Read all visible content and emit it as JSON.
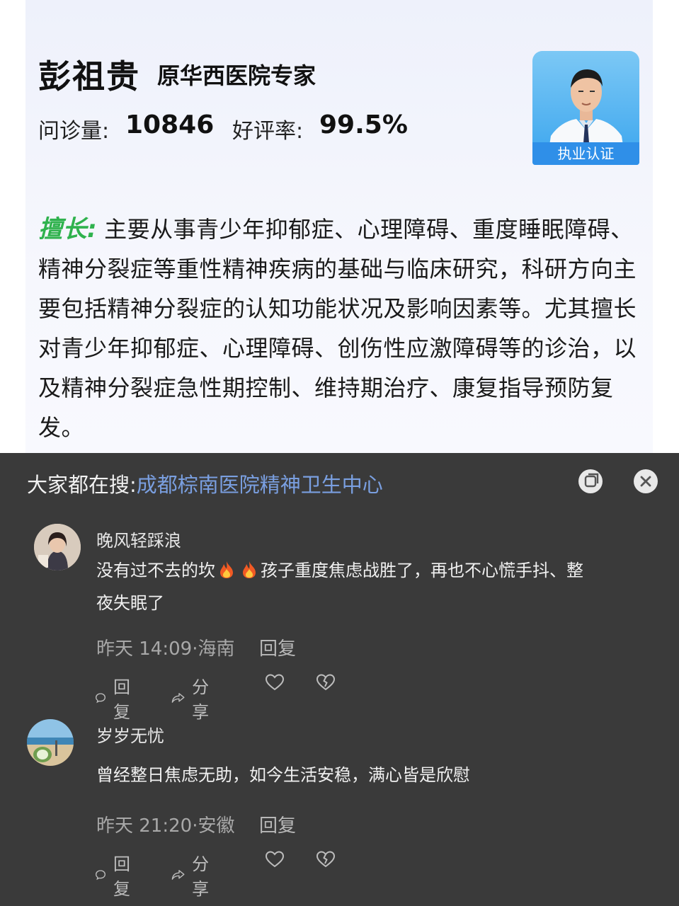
{
  "doctor": {
    "name": "彭祖贵",
    "title": "原华西医院专家",
    "consults_label": "问诊量:",
    "consults_value": "10846",
    "rating_label": "好评率:",
    "rating_value": "99.5%",
    "cert_label": "执业认证",
    "specialty_tag": "擅长:",
    "specialty_text": "主要从事青少年抑郁症、心理障碍、重度睡眠障碍、精神分裂症等重性精神疾病的基础与临床研究，科研方向主要包括精神分裂症的认知功能状况及影响因素等。尤其擅长对青少年抑郁症、心理障碍、创伤性应激障碍等的诊治，以及精神分裂症急性期控制、维持期治疗、康复指导预防复发。"
  },
  "search": {
    "prefix": "大家都在搜:",
    "query": "成都棕南医院精神卫生中心"
  },
  "comments": [
    {
      "user": "晚风轻踩浪",
      "text_part1": "没有过不去的坎",
      "text_part2": "孩子重度焦虑战胜了，再也不心慌手抖、整",
      "text_line2": "夜失眠了",
      "meta": "昨天 14:09·海南",
      "reply": "回复",
      "action_reply": "回复",
      "action_share": "分享"
    },
    {
      "user": "岁岁无忧",
      "text": "曾经整日焦虑无助，如今生活安稳，满心皆是欣慰",
      "meta": "昨天 21:20·安徽",
      "reply": "回复",
      "action_reply": "回复",
      "action_share": "分享"
    }
  ]
}
